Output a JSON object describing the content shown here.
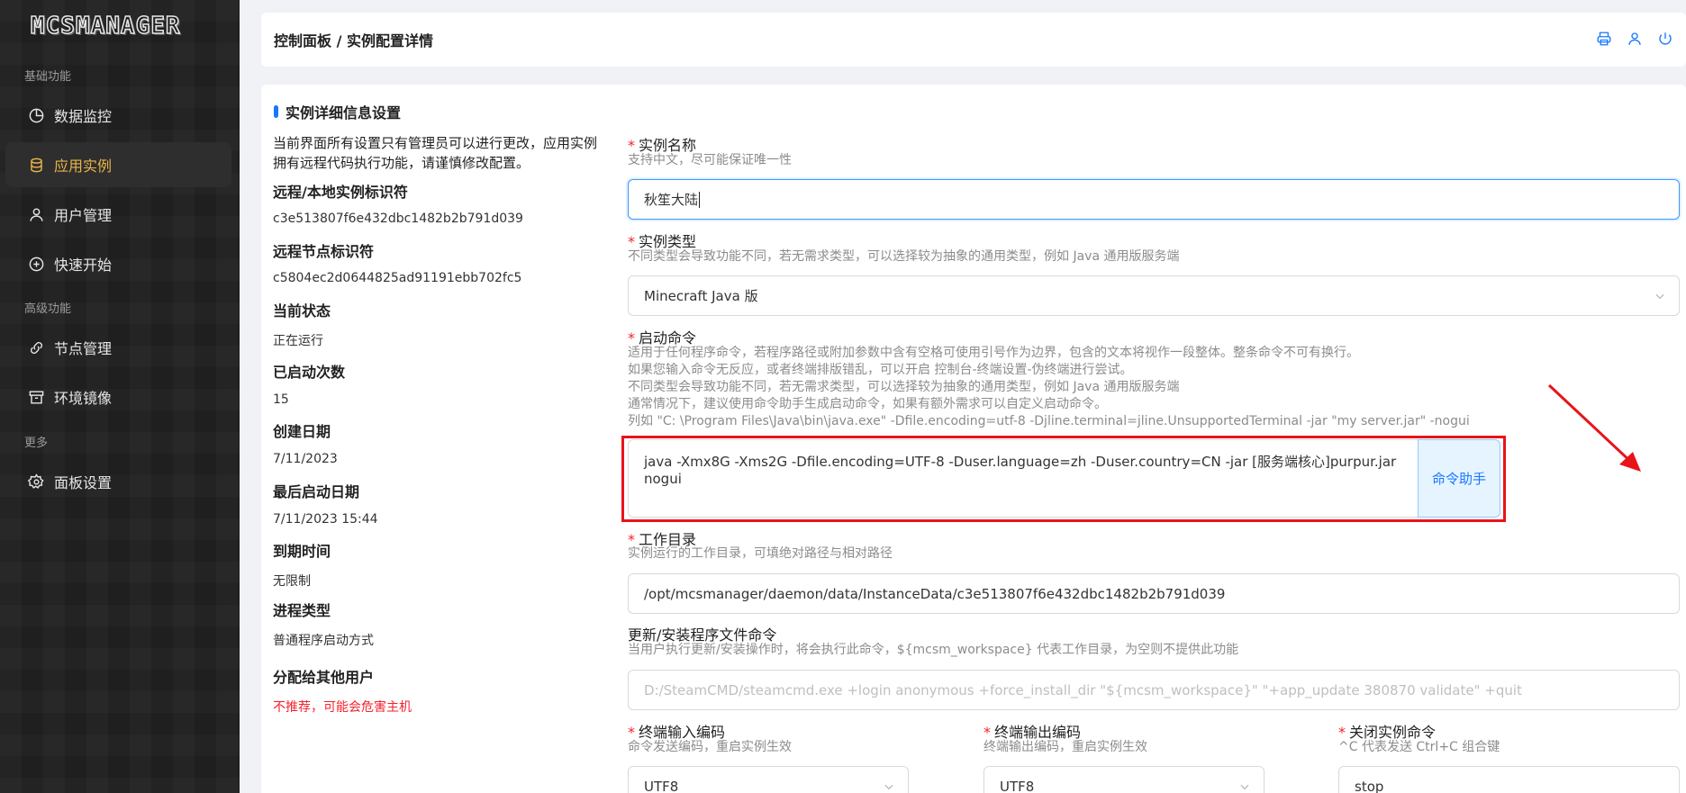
{
  "sidebar": {
    "logo": "MCSMANAGER",
    "groups": {
      "basic": "基础功能",
      "advanced": "高级功能",
      "more": "更多"
    },
    "items": [
      {
        "label": "数据监控",
        "icon": "pie-chart-icon"
      },
      {
        "label": "应用实例",
        "icon": "database-icon"
      },
      {
        "label": "用户管理",
        "icon": "user-icon"
      },
      {
        "label": "快速开始",
        "icon": "plus-circle-icon"
      },
      {
        "label": "节点管理",
        "icon": "link-icon"
      },
      {
        "label": "环境镜像",
        "icon": "archive-icon"
      },
      {
        "label": "面板设置",
        "icon": "gear-icon"
      }
    ]
  },
  "header": {
    "breadcrumb": "控制面板 / 实例配置详情",
    "icons": [
      "printer-icon",
      "user-icon",
      "power-icon"
    ]
  },
  "card": {
    "title": "实例详细信息设置",
    "note": "当前界面所有设置只有管理员可以进行更改，应用实例拥有远程代码执行功能，请谨慎修改配置。",
    "info": [
      {
        "label": "远程/本地实例标识符",
        "value": "c3e513807f6e432dbc1482b2b791d039"
      },
      {
        "label": "远程节点标识符",
        "value": "c5804ec2d0644825ad91191ebb702fc5"
      },
      {
        "label": "当前状态",
        "value": "正在运行"
      },
      {
        "label": "已启动次数",
        "value": "15"
      },
      {
        "label": "创建日期",
        "value": "7/11/2023"
      },
      {
        "label": "最后启动日期",
        "value": "7/11/2023 15:44"
      },
      {
        "label": "到期时间",
        "value": "无限制"
      },
      {
        "label": "进程类型",
        "value": "普通程序启动方式"
      },
      {
        "label": "分配给其他用户",
        "value": "不推荐，可能会危害主机"
      }
    ]
  },
  "form": {
    "name": {
      "label": "实例名称",
      "help": "支持中文，尽可能保证唯一性",
      "value": "秋笙大陆"
    },
    "type": {
      "label": "实例类型",
      "help": "不同类型会导致功能不同，若无需求类型，可以选择较为抽象的通用类型，例如 Java 通用版服务端",
      "value": "Minecraft Java 版"
    },
    "start": {
      "label": "启动命令",
      "help1": "适用于任何程序命令，若程序路径或附加参数中含有空格可使用引号作为边界，包含的文本将视作一段整体。整条命令不可有换行。",
      "help2": "如果您输入命令无反应，或者终端排版错乱，可以开启 控制台-终端设置-伪终端进行尝试。",
      "help3": "不同类型会导致功能不同，若无需求类型，可以选择较为抽象的通用类型，例如 Java 通用版服务端",
      "help4": "通常情况下，建议使用命令助手生成启动命令，如果有额外需求可以自定义启动命令。",
      "help5": "列如 \"C: \\Program Files\\Java\\bin\\java.exe\" -Dfile.encoding=utf-8 -Djline.terminal=jline.UnsupportedTerminal -jar \"my server.jar\" -nogui",
      "value": "java -Xmx8G -Xms2G -Dfile.encoding=UTF-8 -Duser.language=zh -Duser.country=CN -jar [服务端核心]purpur.jar nogui",
      "helper_button": "命令助手"
    },
    "workdir": {
      "label": "工作目录",
      "help": "实例运行的工作目录，可填绝对路径与相对路径",
      "value": "/opt/mcsmanager/daemon/data/InstanceData/c3e513807f6e432dbc1482b2b791d039"
    },
    "update": {
      "label": "更新/安装程序文件命令",
      "help": "当用户执行更新/安装操作时，将会执行此命令，${mcsm_workspace} 代表工作目录，为空则不提供此功能",
      "placeholder": "D:/SteamCMD/steamcmd.exe +login anonymous +force_install_dir \"${mcsm_workspace}\" \"+app_update 380870 validate\" +quit"
    },
    "in_enc": {
      "label": "终端输入编码",
      "help": "命令发送编码，重启实例生效",
      "value": "UTF8"
    },
    "out_enc": {
      "label": "终端输出编码",
      "help": "终端输出编码，重启实例生效",
      "value": "UTF8"
    },
    "stop": {
      "label": "关闭实例命令",
      "help": "^C 代表发送 Ctrl+C 组合键",
      "value": "stop"
    }
  }
}
